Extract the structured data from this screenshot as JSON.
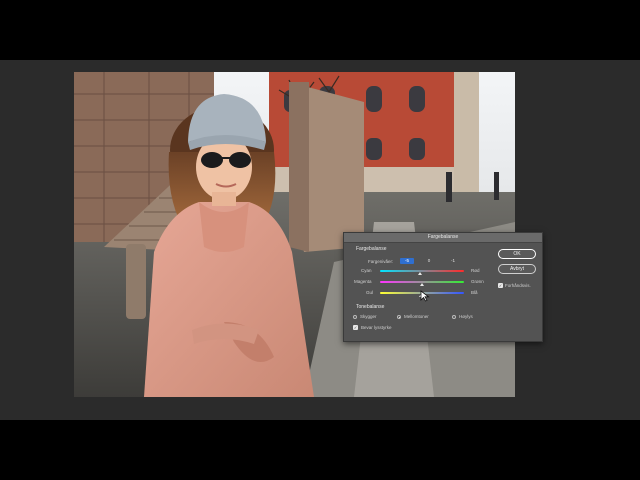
{
  "dialog": {
    "title": "Fargebalanse",
    "section_color": "Fargebalanse",
    "levels_label": "Fargenivåer:",
    "levels": [
      "-5",
      "0",
      "-1"
    ],
    "sliders": [
      {
        "left": "Cyan",
        "right": "Rød",
        "value": -5
      },
      {
        "left": "Magenta",
        "right": "Grønn",
        "value": 0
      },
      {
        "left": "Gul",
        "right": "Blå",
        "value": -1
      }
    ],
    "section_tone": "Tonebalanse",
    "tones": [
      "Skygger",
      "Mellomtoner",
      "Høylys"
    ],
    "tone_selected": "Mellomtoner",
    "preserve_label": "Bevar lysstyrke",
    "preserve_checked": true,
    "ok_label": "OK",
    "cancel_label": "Avbryt",
    "preview_label": "Forhåndsvis.",
    "preview_checked": true
  },
  "colors": {
    "workspace": "#2b2b2b",
    "dialog_bg": "#535353",
    "accent": "#2f6fd0"
  }
}
